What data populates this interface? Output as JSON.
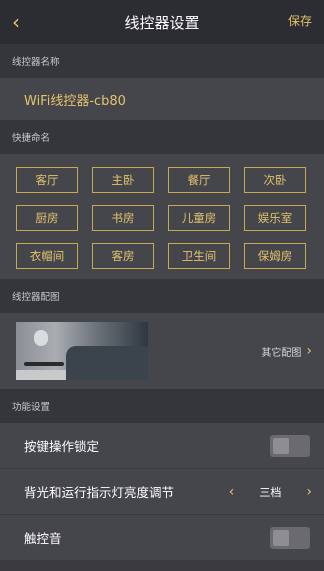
{
  "header": {
    "title": "线控器设置",
    "save_label": "保存"
  },
  "sections": {
    "name_label": "线控器名称",
    "quick_label": "快捷命名",
    "config_label": "线控器配图",
    "function_label": "功能设置"
  },
  "controller_name": "WiFi线控器-cb80",
  "quick_names": [
    "客厅",
    "主卧",
    "餐厅",
    "次卧",
    "厨房",
    "书房",
    "儿童房",
    "娱乐室",
    "衣帽间",
    "客房",
    "卫生间",
    "保姆房"
  ],
  "config": {
    "other_label": "其它配图"
  },
  "settings": {
    "key_lock_label": "按键操作锁定",
    "key_lock_on": false,
    "brightness_label": "背光和运行指示灯亮度调节",
    "brightness_value": "三档",
    "touch_sound_label": "触控音",
    "touch_sound_on": false
  },
  "colors": {
    "accent": "#e3c46a",
    "background": "#3a3a40",
    "panel": "#45454c"
  }
}
